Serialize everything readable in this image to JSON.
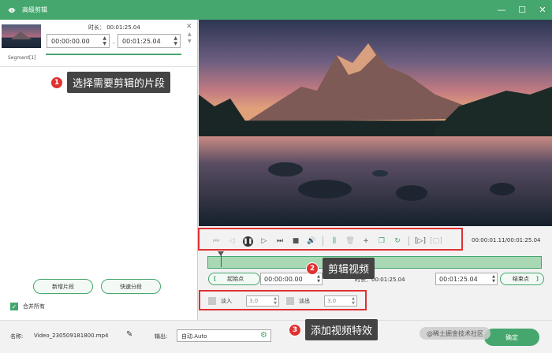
{
  "window": {
    "title": "高级剪辑",
    "buttons": {
      "minimize": "—",
      "maximize": "☐",
      "close": "✕"
    }
  },
  "segment_list": {
    "duration_label": "时长： 00:01:25.04",
    "start_time": "00:00:00.00",
    "end_time": "00:01:25.04",
    "dash": "-",
    "segment_name": "Segment[1]",
    "close": "✕"
  },
  "left_buttons": {
    "new_segment": "新增片段",
    "quick_split": "快速分段"
  },
  "merge_all": {
    "checked": true,
    "label": "合并所有"
  },
  "player": {
    "timecode": "00:00:01.11/00:01:25.04"
  },
  "trim": {
    "start_point": "起始点",
    "start_time": "00:00:00.00",
    "duration_label": "时长：00:01:25.04",
    "end_time": "00:01:25.04",
    "end_point": "结束点",
    "bracket_left": "[",
    "bracket_right": "]"
  },
  "fade": {
    "fade_in_label": "淡入",
    "fade_in_value": "3.0",
    "fade_out_label": "淡出",
    "fade_out_value": "3.0",
    "fade_in_checked": false,
    "fade_out_checked": false
  },
  "bottom": {
    "name_label": "名称:",
    "file_name": "Video_230509181800.mp4",
    "output_label": "输出:",
    "output_value": "自动.Auto",
    "ok_button": "确定"
  },
  "annotations": {
    "callout1": {
      "num": "1",
      "text": "选择需要剪辑的片段"
    },
    "callout2": {
      "num": "2",
      "text": "剪辑视频"
    },
    "callout3": {
      "num": "3",
      "text": "添加视频特效"
    },
    "color": "#e03131"
  },
  "watermark": "@稀土掘金技术社区",
  "colors": {
    "accent": "#45a76e",
    "annotation": "#e03131"
  }
}
